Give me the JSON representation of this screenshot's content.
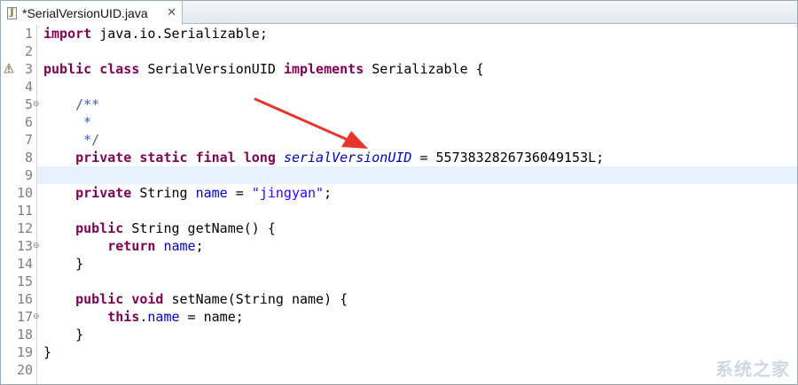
{
  "tab": {
    "title": "*SerialVersionUID.java",
    "close": "✕",
    "icon_letter": "J"
  },
  "lines": [
    {
      "n": "1"
    },
    {
      "n": "2"
    },
    {
      "n": "3"
    },
    {
      "n": "4"
    },
    {
      "n": "5"
    },
    {
      "n": "6"
    },
    {
      "n": "7"
    },
    {
      "n": "8"
    },
    {
      "n": "9"
    },
    {
      "n": "10"
    },
    {
      "n": "11"
    },
    {
      "n": "12"
    },
    {
      "n": "13"
    },
    {
      "n": "14"
    },
    {
      "n": "15"
    },
    {
      "n": "16"
    },
    {
      "n": "17"
    },
    {
      "n": "18"
    },
    {
      "n": "19"
    },
    {
      "n": "20"
    }
  ],
  "fold_marker": "⊖",
  "code": {
    "l1_kw": "import",
    "l1_rest": " java.io.Serializable;",
    "l3_kw1": "public",
    "l3_kw2": "class",
    "l3_name": " SerialVersionUID ",
    "l3_kw3": "implements",
    "l3_rest": " Serializable {",
    "l5": "    /**",
    "l6": "     *",
    "l7": "     */",
    "l8_kw": "    private static final long ",
    "l8_field": "serialVersionUID",
    "l8_rest": " = 5573832826736049153L;",
    "l10_kw": "    private",
    "l10_type": " String ",
    "l10_field": "name",
    "l10_eq": " = ",
    "l10_str": "\"jingyan\"",
    "l10_end": ";",
    "l12_kw": "    public",
    "l12_rest": " String getName() {",
    "l13_kw": "        return",
    "l13_sp": " ",
    "l13_field": "name",
    "l13_end": ";",
    "l14": "    }",
    "l16_kw": "    public void",
    "l16_rest": " setName(String name) {",
    "l17_kw": "        this",
    "l17_dot": ".",
    "l17_field": "name",
    "l17_rest": " = name;",
    "l18": "    }",
    "l19": "}"
  },
  "watermark": "系统之家",
  "colors": {
    "keyword": "#7f0055",
    "comment": "#3f5fbf",
    "field": "#0000c0",
    "string": "#2a00ff",
    "current_line": "#e8f2fe",
    "arrow": "#e8352b"
  }
}
